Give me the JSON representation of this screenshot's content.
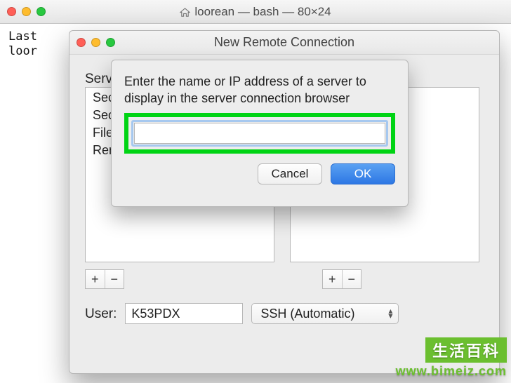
{
  "terminal": {
    "title": "loorean — bash — 80×24",
    "body": "Last\nloor"
  },
  "nrc": {
    "title": "New Remote Connection",
    "service_label": "Servic",
    "services": [
      "Secur",
      "Secur",
      "File Tr",
      "Remo"
    ],
    "add_label": "+",
    "remove_label": "−",
    "user_label": "User:",
    "user_value": "K53PDX",
    "protocol_value": "SSH (Automatic)"
  },
  "sheet": {
    "message": "Enter the name or IP address of a server to display in the server connection browser",
    "input_value": "",
    "cancel_label": "Cancel",
    "ok_label": "OK"
  },
  "watermark": {
    "top": "生活百科",
    "bottom": "www.bimeiz.com"
  }
}
